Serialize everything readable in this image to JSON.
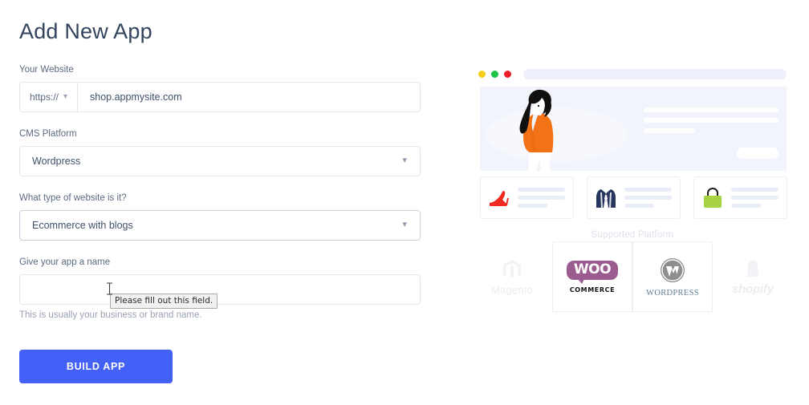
{
  "page": {
    "title": "Add New App"
  },
  "form": {
    "website": {
      "label": "Your Website",
      "protocol": "https://",
      "protocol_chevron_icon": "chevron-down-icon",
      "value": "shop.appmysite.com"
    },
    "cms": {
      "label": "CMS Platform",
      "value": "Wordpress",
      "chevron_icon": "chevron-down-icon"
    },
    "website_type": {
      "label": "What type of website is it?",
      "value": "Ecommerce with blogs",
      "chevron_icon": "chevron-down-icon"
    },
    "app_name": {
      "label": "Give your app a name",
      "value": "",
      "placeholder": "",
      "helper": "This is usually your business or brand name.",
      "validation_tooltip": "Please fill out this field."
    },
    "submit": {
      "label": "BUILD APP",
      "color": "#4360f7"
    }
  },
  "illustration": {
    "browser": {
      "dots": [
        {
          "name": "yellow-dot",
          "color": "#f5cf1b"
        },
        {
          "name": "green-dot",
          "color": "#1dc44a"
        },
        {
          "name": "red-dot",
          "color": "#ec1d25"
        }
      ],
      "hero": {
        "background": "#f2f4fc",
        "figure": "woman-in-orange-top-illustration",
        "accent_color": "#f47216"
      }
    },
    "product_cards": [
      {
        "icon": "high-heel-shoe-icon",
        "color": "#ee2a23"
      },
      {
        "icon": "blazer-jacket-icon",
        "color": "#27365e"
      },
      {
        "icon": "handbag-icon",
        "color": "#a8d241"
      }
    ],
    "supported_heading": "Supported Platform",
    "platforms": [
      {
        "name": "Magento",
        "icon": "magento-logo-icon",
        "state": "inactive"
      },
      {
        "name": "WOO",
        "sub": "COMMERCE",
        "icon": "woocommerce-logo-icon",
        "state": "active",
        "color": "#9b5c8f"
      },
      {
        "name": "WordPress",
        "sub": "WORDPRESS",
        "icon": "wordpress-logo-icon",
        "state": "active",
        "color": "#7d7d7d"
      },
      {
        "name": "shopify",
        "icon": "shopify-logo-icon",
        "state": "inactive"
      }
    ]
  }
}
